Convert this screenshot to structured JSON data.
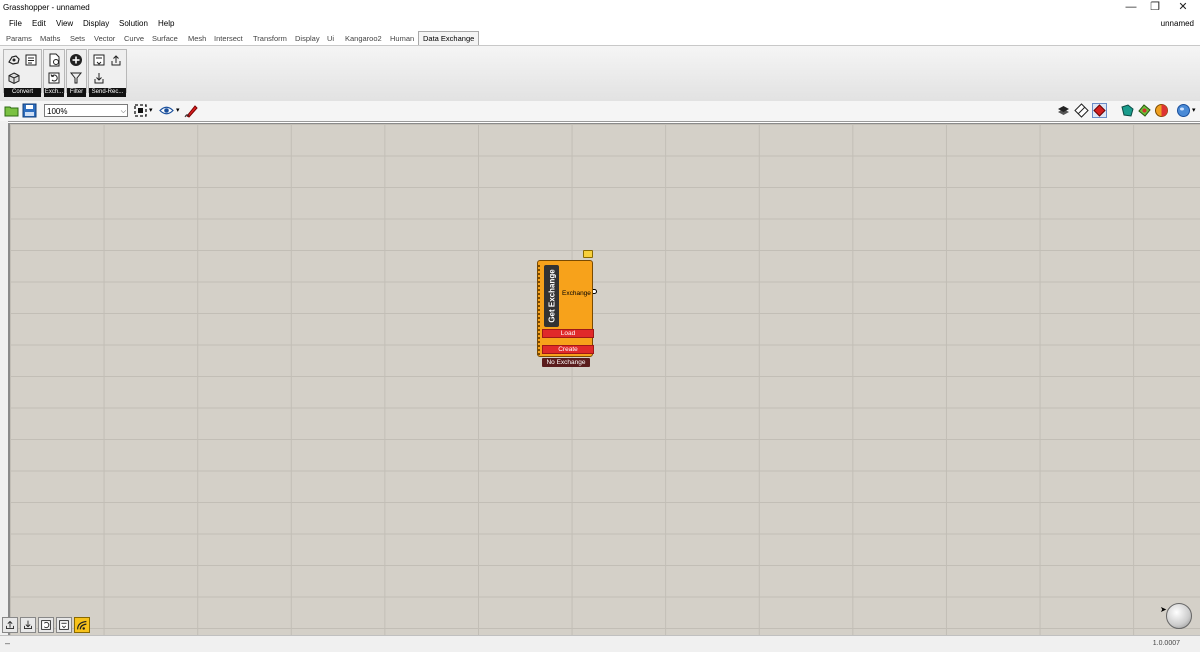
{
  "window": {
    "title": "Grasshopper - unnamed",
    "minimize": "—",
    "restore": "❐",
    "close": "✕"
  },
  "menubar": {
    "items": [
      "File",
      "Edit",
      "View",
      "Display",
      "Solution",
      "Help"
    ],
    "document_name": "unnamed"
  },
  "tabs": {
    "items": [
      "Params",
      "Maths",
      "Sets",
      "Vector",
      "Curve",
      "Surface",
      "Mesh",
      "Intersect",
      "Transform",
      "Display",
      "Ui",
      "Kangaroo2",
      "Human",
      "Data Exchange"
    ],
    "active": "Data Exchange"
  },
  "ribbon": {
    "groups": [
      {
        "label": "Convert",
        "icons": [
          "rhino-icon",
          "list-icon",
          "cube-icon"
        ]
      },
      {
        "label": "Exch...",
        "icons": [
          "doc-icon",
          "refresh-icon"
        ]
      },
      {
        "label": "Filter",
        "icons": [
          "add-circle-icon",
          "filter-icon"
        ]
      },
      {
        "label": "Send-Rec...",
        "icons": [
          "receive-icon",
          "upload-icon",
          "download-icon"
        ]
      }
    ]
  },
  "toolbar": {
    "zoom": "100%"
  },
  "component": {
    "name": "Get Exchange",
    "output": "Exchange",
    "buttons": [
      "Load",
      "Create"
    ],
    "status": "No Exchange"
  },
  "statusbar": {
    "left": "–",
    "version": "1.0.0007"
  },
  "colors": {
    "canvas": "#d4d0c8",
    "component": "#f7a21b",
    "button_red": "#e02a2a",
    "status_bg": "#5a1c1c"
  }
}
